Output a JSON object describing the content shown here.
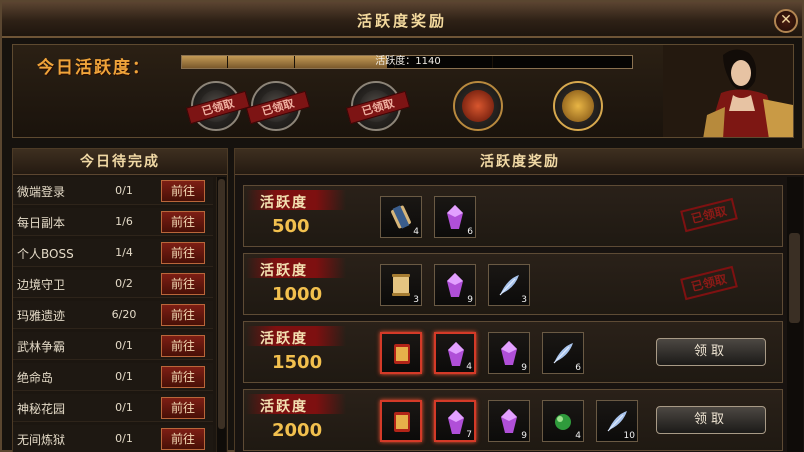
{
  "window": {
    "title": "活跃度奖励",
    "close_glyph": "✕"
  },
  "activity": {
    "label": "今日活跃度：",
    "progress_text": "活跃度：1140",
    "progress_fraction": 0.456,
    "chests": [
      {
        "state": "claimed",
        "stamp": "已领取",
        "icon": "silver-chest-icon"
      },
      {
        "state": "claimed",
        "stamp": "已领取",
        "icon": "silver-chest-icon"
      },
      {
        "state": "claimed",
        "stamp": "已领取",
        "icon": "silver-chest-icon"
      },
      {
        "state": "available",
        "stamp": "",
        "icon": "red-chest-icon"
      },
      {
        "state": "available",
        "stamp": "",
        "icon": "gold-chest-icon"
      }
    ]
  },
  "tasks": {
    "title": "今日待完成",
    "go_label": "前往",
    "items": [
      {
        "name": "微端登录",
        "progress": "0/1"
      },
      {
        "name": "每日副本",
        "progress": "1/6"
      },
      {
        "name": "个人BOSS",
        "progress": "1/4"
      },
      {
        "name": "边境守卫",
        "progress": "0/2"
      },
      {
        "name": "玛雅遗迹",
        "progress": "6/20"
      },
      {
        "name": "武林争霸",
        "progress": "0/1"
      },
      {
        "name": "绝命岛",
        "progress": "0/1"
      },
      {
        "name": "神秘花园",
        "progress": "0/1"
      },
      {
        "name": "无间炼狱",
        "progress": "0/1"
      }
    ]
  },
  "rewards": {
    "title": "活跃度奖励",
    "row_label": "活跃度",
    "claimed_stamp": "已领取",
    "claim_label": "领取",
    "rows": [
      {
        "value": "500",
        "state": "claimed",
        "items": [
          {
            "icon": "scroll-icon",
            "count": "4"
          },
          {
            "icon": "purple-gem-icon",
            "count": "6"
          }
        ]
      },
      {
        "value": "1000",
        "state": "claimed",
        "items": [
          {
            "icon": "gold-scroll-icon",
            "count": "3"
          },
          {
            "icon": "purple-gem-icon",
            "count": "9"
          },
          {
            "icon": "feather-icon",
            "count": "3"
          }
        ]
      },
      {
        "value": "1500",
        "state": "available",
        "items": [
          {
            "icon": "red-scroll-icon",
            "count": ""
          },
          {
            "icon": "purple-gem-icon",
            "count": "4"
          },
          {
            "icon": "purple-gem-icon",
            "count": "9"
          },
          {
            "icon": "feather-icon",
            "count": "6"
          }
        ]
      },
      {
        "value": "2000",
        "state": "available",
        "items": [
          {
            "icon": "red-scroll-icon",
            "count": ""
          },
          {
            "icon": "purple-gem-icon",
            "count": "7"
          },
          {
            "icon": "purple-gem-icon",
            "count": "9"
          },
          {
            "icon": "green-orb-icon",
            "count": "4"
          },
          {
            "icon": "feather-icon",
            "count": "10"
          }
        ]
      }
    ]
  },
  "colors": {
    "accent_orange": "#f0a43a",
    "value_gold": "#f2c04e",
    "stamp_red": "#7e1111"
  }
}
